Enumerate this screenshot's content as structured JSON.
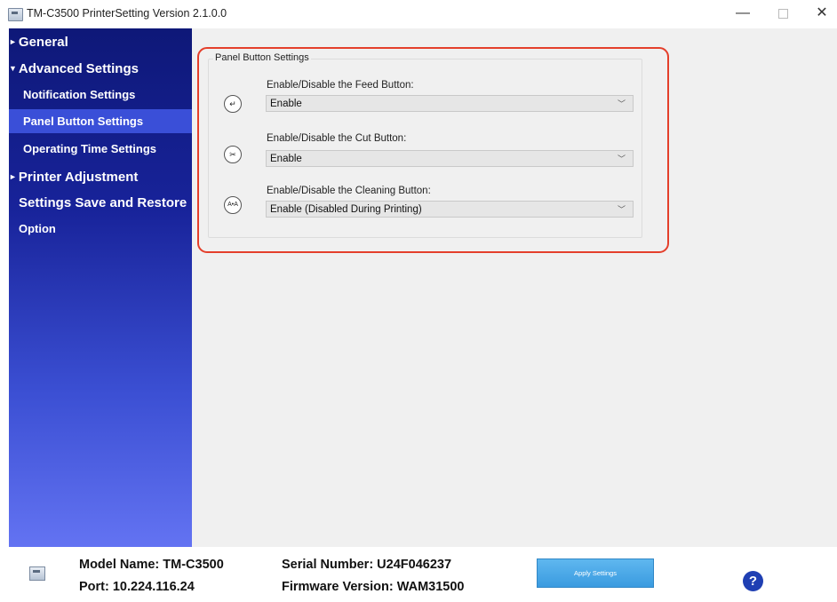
{
  "window": {
    "title": "TM-C3500 PrinterSetting Version 2.1.0.0",
    "minimize_glyph": "—",
    "close_glyph": "✕"
  },
  "sidebar": {
    "items": [
      {
        "label": "General",
        "arrow": "►"
      },
      {
        "label": "Advanced Settings",
        "arrow": "▼"
      },
      {
        "label": "Notification Settings"
      },
      {
        "label": "Panel Button Settings",
        "selected": true
      },
      {
        "label": "Operating Time Settings"
      },
      {
        "label": "Printer Adjustment",
        "arrow": "►"
      },
      {
        "label": "Settings Save and Restore"
      },
      {
        "label": "Option"
      }
    ]
  },
  "panel": {
    "group_title": "Panel Button Settings",
    "highlight_color": "#e43f2b",
    "rows": [
      {
        "icon": "feed-button-icon",
        "icon_glyph": "↵",
        "label": "Enable/Disable the Feed Button:",
        "value": "Enable"
      },
      {
        "icon": "cut-button-icon",
        "icon_glyph": "✂",
        "label": "Enable/Disable the Cut Button:",
        "value": "Enable"
      },
      {
        "icon": "cleaning-button-icon",
        "icon_glyph": "A•A",
        "label": "Enable/Disable the Cleaning Button:",
        "value": "Enable (Disabled During Printing)"
      }
    ]
  },
  "footer": {
    "model": "Model Name: TM-C3500",
    "port": "Port: 10.224.116.24",
    "serial": "Serial Number: U24F046237",
    "firmware": "Firmware Version: WAM31500",
    "apply_label": "Apply Settings",
    "help_glyph": "?"
  }
}
